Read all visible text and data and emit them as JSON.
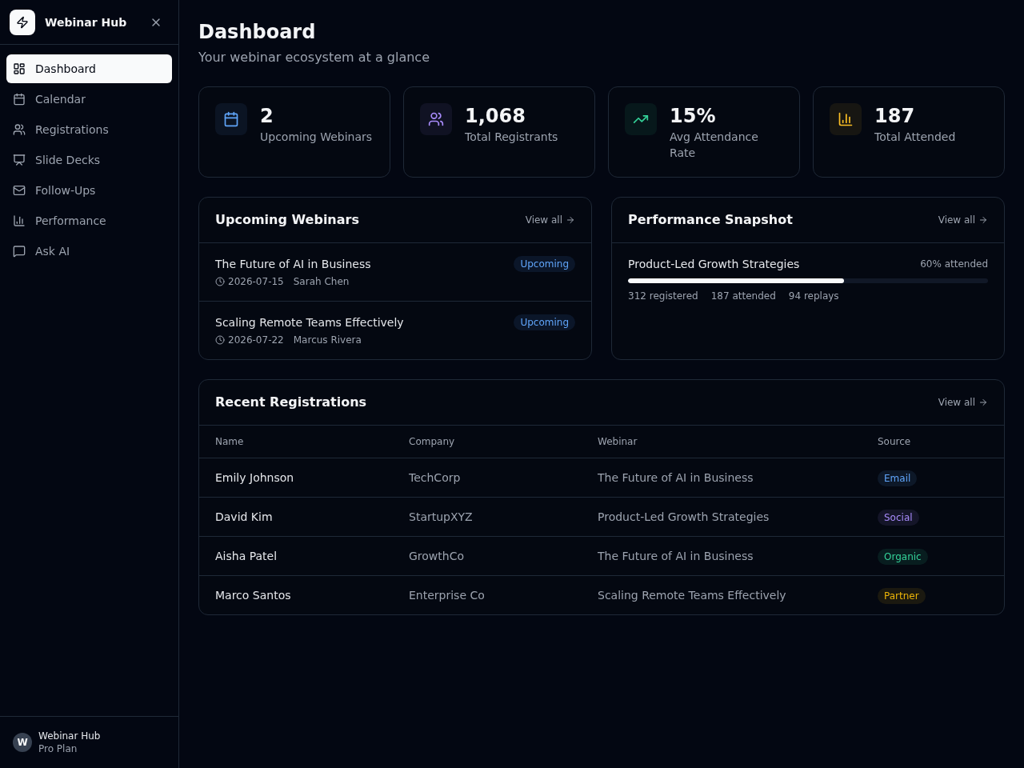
{
  "sidebar": {
    "brand": "Webinar Hub",
    "nav": [
      {
        "label": "Dashboard",
        "selected": true
      },
      {
        "label": "Calendar",
        "selected": false
      },
      {
        "label": "Registrations",
        "selected": false
      },
      {
        "label": "Slide Decks",
        "selected": false
      },
      {
        "label": "Follow-Ups",
        "selected": false
      },
      {
        "label": "Performance",
        "selected": false
      },
      {
        "label": "Ask AI",
        "selected": false
      }
    ],
    "footer": {
      "avatar": "W",
      "name": "Webinar Hub",
      "plan": "Pro Plan"
    }
  },
  "header": {
    "title": "Dashboard",
    "subtitle": "Your webinar ecosystem at a glance"
  },
  "stats": [
    {
      "value": "2",
      "label": "Upcoming Webinars",
      "color": "#60a5fa"
    },
    {
      "value": "1,068",
      "label": "Total Registrants",
      "color": "#a78bfa"
    },
    {
      "value": "15%",
      "label": "Avg Attendance Rate",
      "color": "#34d399"
    },
    {
      "value": "187",
      "label": "Total Attended",
      "color": "#fbbf24"
    }
  ],
  "upcoming_webinars": {
    "title": "Upcoming Webinars",
    "link": "View all",
    "items": [
      {
        "title": "The Future of AI in Business",
        "date": "2026-07-15",
        "host": "Sarah Chen",
        "status": "Upcoming"
      },
      {
        "title": "Scaling Remote Teams Effectively",
        "date": "2026-07-22",
        "host": "Marcus Rivera",
        "status": "Upcoming"
      }
    ]
  },
  "performance_snapshot": {
    "title": "Performance Snapshot",
    "link": "View all",
    "items": [
      {
        "title": "Product-Led Growth Strategies",
        "rate": "60% attended",
        "level": 0.6,
        "registered": "312 registered",
        "attended": "187 attended",
        "replays": "94 replays"
      }
    ]
  },
  "recent_registrations": {
    "title": "Recent Registrations",
    "link": "View all",
    "columns": [
      "Name",
      "Company",
      "Webinar",
      "Source"
    ],
    "rows": [
      {
        "name": "Emily Johnson",
        "company": "TechCorp",
        "webinar": "The Future of AI in Business",
        "source": {
          "label": "Email",
          "color": "#60a5fa"
        }
      },
      {
        "name": "David Kim",
        "company": "StartupXYZ",
        "webinar": "Product-Led Growth Strategies",
        "source": {
          "label": "Social",
          "color": "#a78bfa"
        }
      },
      {
        "name": "Aisha Patel",
        "company": "GrowthCo",
        "webinar": "The Future of AI in Business",
        "source": {
          "label": "Organic",
          "color": "#34d399"
        }
      },
      {
        "name": "Marco Santos",
        "company": "Enterprise Co",
        "webinar": "Scaling Remote Teams Effectively",
        "source": {
          "label": "Partner",
          "color": "#eab308"
        }
      }
    ]
  }
}
